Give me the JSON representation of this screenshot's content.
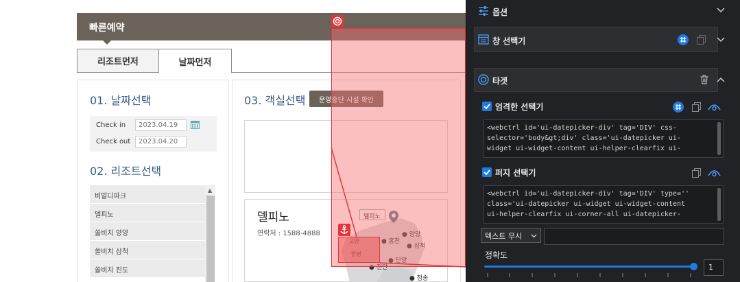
{
  "site": {
    "quick_booking": "빠른예약",
    "tabs": [
      "리조트먼저",
      "날짜먼저"
    ],
    "date_section_title": "01. 날짜선택",
    "check_in_label": "Check in",
    "check_in_value": "2023.04.19",
    "check_out_label": "Check out",
    "check_out_value": "2023.04.20",
    "resort_section_title": "02. 리조트선택",
    "resorts": [
      "비발디파크",
      "델피노",
      "쏠비치 양양",
      "쏠비치 삼척",
      "쏠비치 진도"
    ],
    "room_section_title": "03. 객실선택",
    "notice_button": "운영중단 시설 확인",
    "card_title": "델피노",
    "card_contact": "연락처 : 1588-4888",
    "map": {
      "pin_label": "델피노",
      "places": [
        "양양",
        "홍천",
        "삼척",
        "고양",
        "양평",
        "단양",
        "천안",
        "청송"
      ]
    }
  },
  "panel": {
    "options_label": "옵션",
    "window_selector_label": "창 선택기",
    "target_label": "타겟",
    "strict_selector_label": "엄격한 선택기",
    "strict_selector_code": [
      "<webctrl id='ui-datepicker-div' tag='DIV' css-",
      "  selector='body&gt;div' class='ui-datepicker ui-",
      "  widget ui-widget-content ui-helper-clearfix ui-"
    ],
    "fuzzy_selector_label": "퍼지 선택기",
    "fuzzy_selector_code": [
      "<webctrl id='ui-datepicker-div' tag='DIV' type=''",
      "  class='ui-datepicker ui-widget ui-widget-content",
      "  ui-helper-clearfix ui-corner-all ui-datepicker-"
    ],
    "text_mode_value": "텍스트 무시",
    "text_value": "",
    "accuracy_label": "정확도",
    "accuracy_value": "1",
    "accuracy_fraction": 1.0
  },
  "colors": {
    "brand_brown": "#6b6259",
    "highlight_red": "#e0383a",
    "accent_blue": "#1e7be0",
    "panel_bg": "#202225"
  },
  "icons": [
    "target-icon",
    "anchor-icon",
    "calendar-icon",
    "sliders-icon",
    "window-icon",
    "selector-grid-icon",
    "copy-icon",
    "chevron-down-icon",
    "chevron-up-icon",
    "trash-icon",
    "eye-icon",
    "map-pin-icon"
  ]
}
